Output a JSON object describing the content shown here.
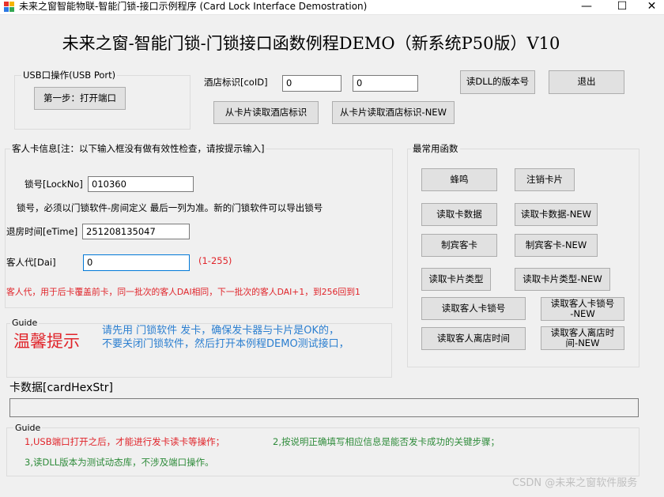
{
  "window": {
    "title": "未来之窗智能物联-智能门锁-接口示例程序 (Card Lock Interface Demostration)",
    "minimize_glyph": "—",
    "maximize_glyph": "☐",
    "close_glyph": "✕"
  },
  "heading": "未来之窗-智能门锁-门锁接口函数例程DEMO（新系统P50版）V10",
  "usb": {
    "group_label": "USB口操作(USB Port)",
    "open_port_button": "第一步：打开端口"
  },
  "hotel": {
    "label": "酒店标识[coID]",
    "value1": "0",
    "value2": "0",
    "read_id_button": "从卡片读取酒店标识",
    "read_id_new_button": "从卡片读取酒店标识-NEW",
    "dll_version_button": "读DLL的版本号",
    "exit_button": "退出"
  },
  "guest": {
    "group_label": "客人卡信息[注：以下输入框没有做有效性检查，请按提示输入]",
    "lock_label": "锁号[LockNo]",
    "lock_value": "010360",
    "lock_note": "锁号，必须以门锁软件-房间定义 最后一列为准。新的门锁软件可以导出锁号",
    "etime_label": "退房时间[eTime]",
    "etime_value": "251208135047",
    "dai_label": "客人代[Dai]",
    "dai_value": "0",
    "dai_range": "(1-255)",
    "dai_note": "客人代，用于后卡覆盖前卡，同一批次的客人DAI相同，下一批次的客人DAI+1，到256回到1"
  },
  "functions": {
    "group_label": "最常用函数",
    "buzzer": "蜂鸣",
    "cancel_card": "注销卡片",
    "read_card_data": "读取卡数据",
    "read_card_data_new": "读取卡数据-NEW",
    "make_guest_card": "制宾客卡",
    "make_guest_card_new": "制宾客卡-NEW",
    "read_card_type": "读取卡片类型",
    "read_card_type_new": "读取卡片类型-NEW",
    "read_guest_lock": "读取客人卡锁号",
    "read_guest_lock_new": "读取客人卡锁号\n-NEW",
    "read_checkout_time": "读取客人离店时间",
    "read_checkout_time_new": "读取客人离店时\n间-NEW"
  },
  "guide1": {
    "label": "Guide",
    "warm_tip": "温馨提示",
    "line1": "请先用 门锁软件 发卡，确保发卡器与卡片是OK的，",
    "line2": "不要关闭门锁软件，然后打开本例程DEMO测试接口，"
  },
  "card_data": {
    "label": "卡数据[cardHexStr]",
    "value": ""
  },
  "guide2": {
    "label": "Guide",
    "step1": "1,USB端口打开之后，才能进行发卡读卡等操作；",
    "step2": "2,按说明正确填写相应信息是能否发卡成功的关键步骤；",
    "step3": "3,读DLL版本为测试动态库，不涉及端口操作。"
  },
  "watermark": "CSDN @未来之窗软件服务",
  "colors": {
    "red": "#e0242a",
    "blue": "#2c7fd0",
    "green": "#2e8b3a",
    "focus_border": "#0078d7"
  }
}
